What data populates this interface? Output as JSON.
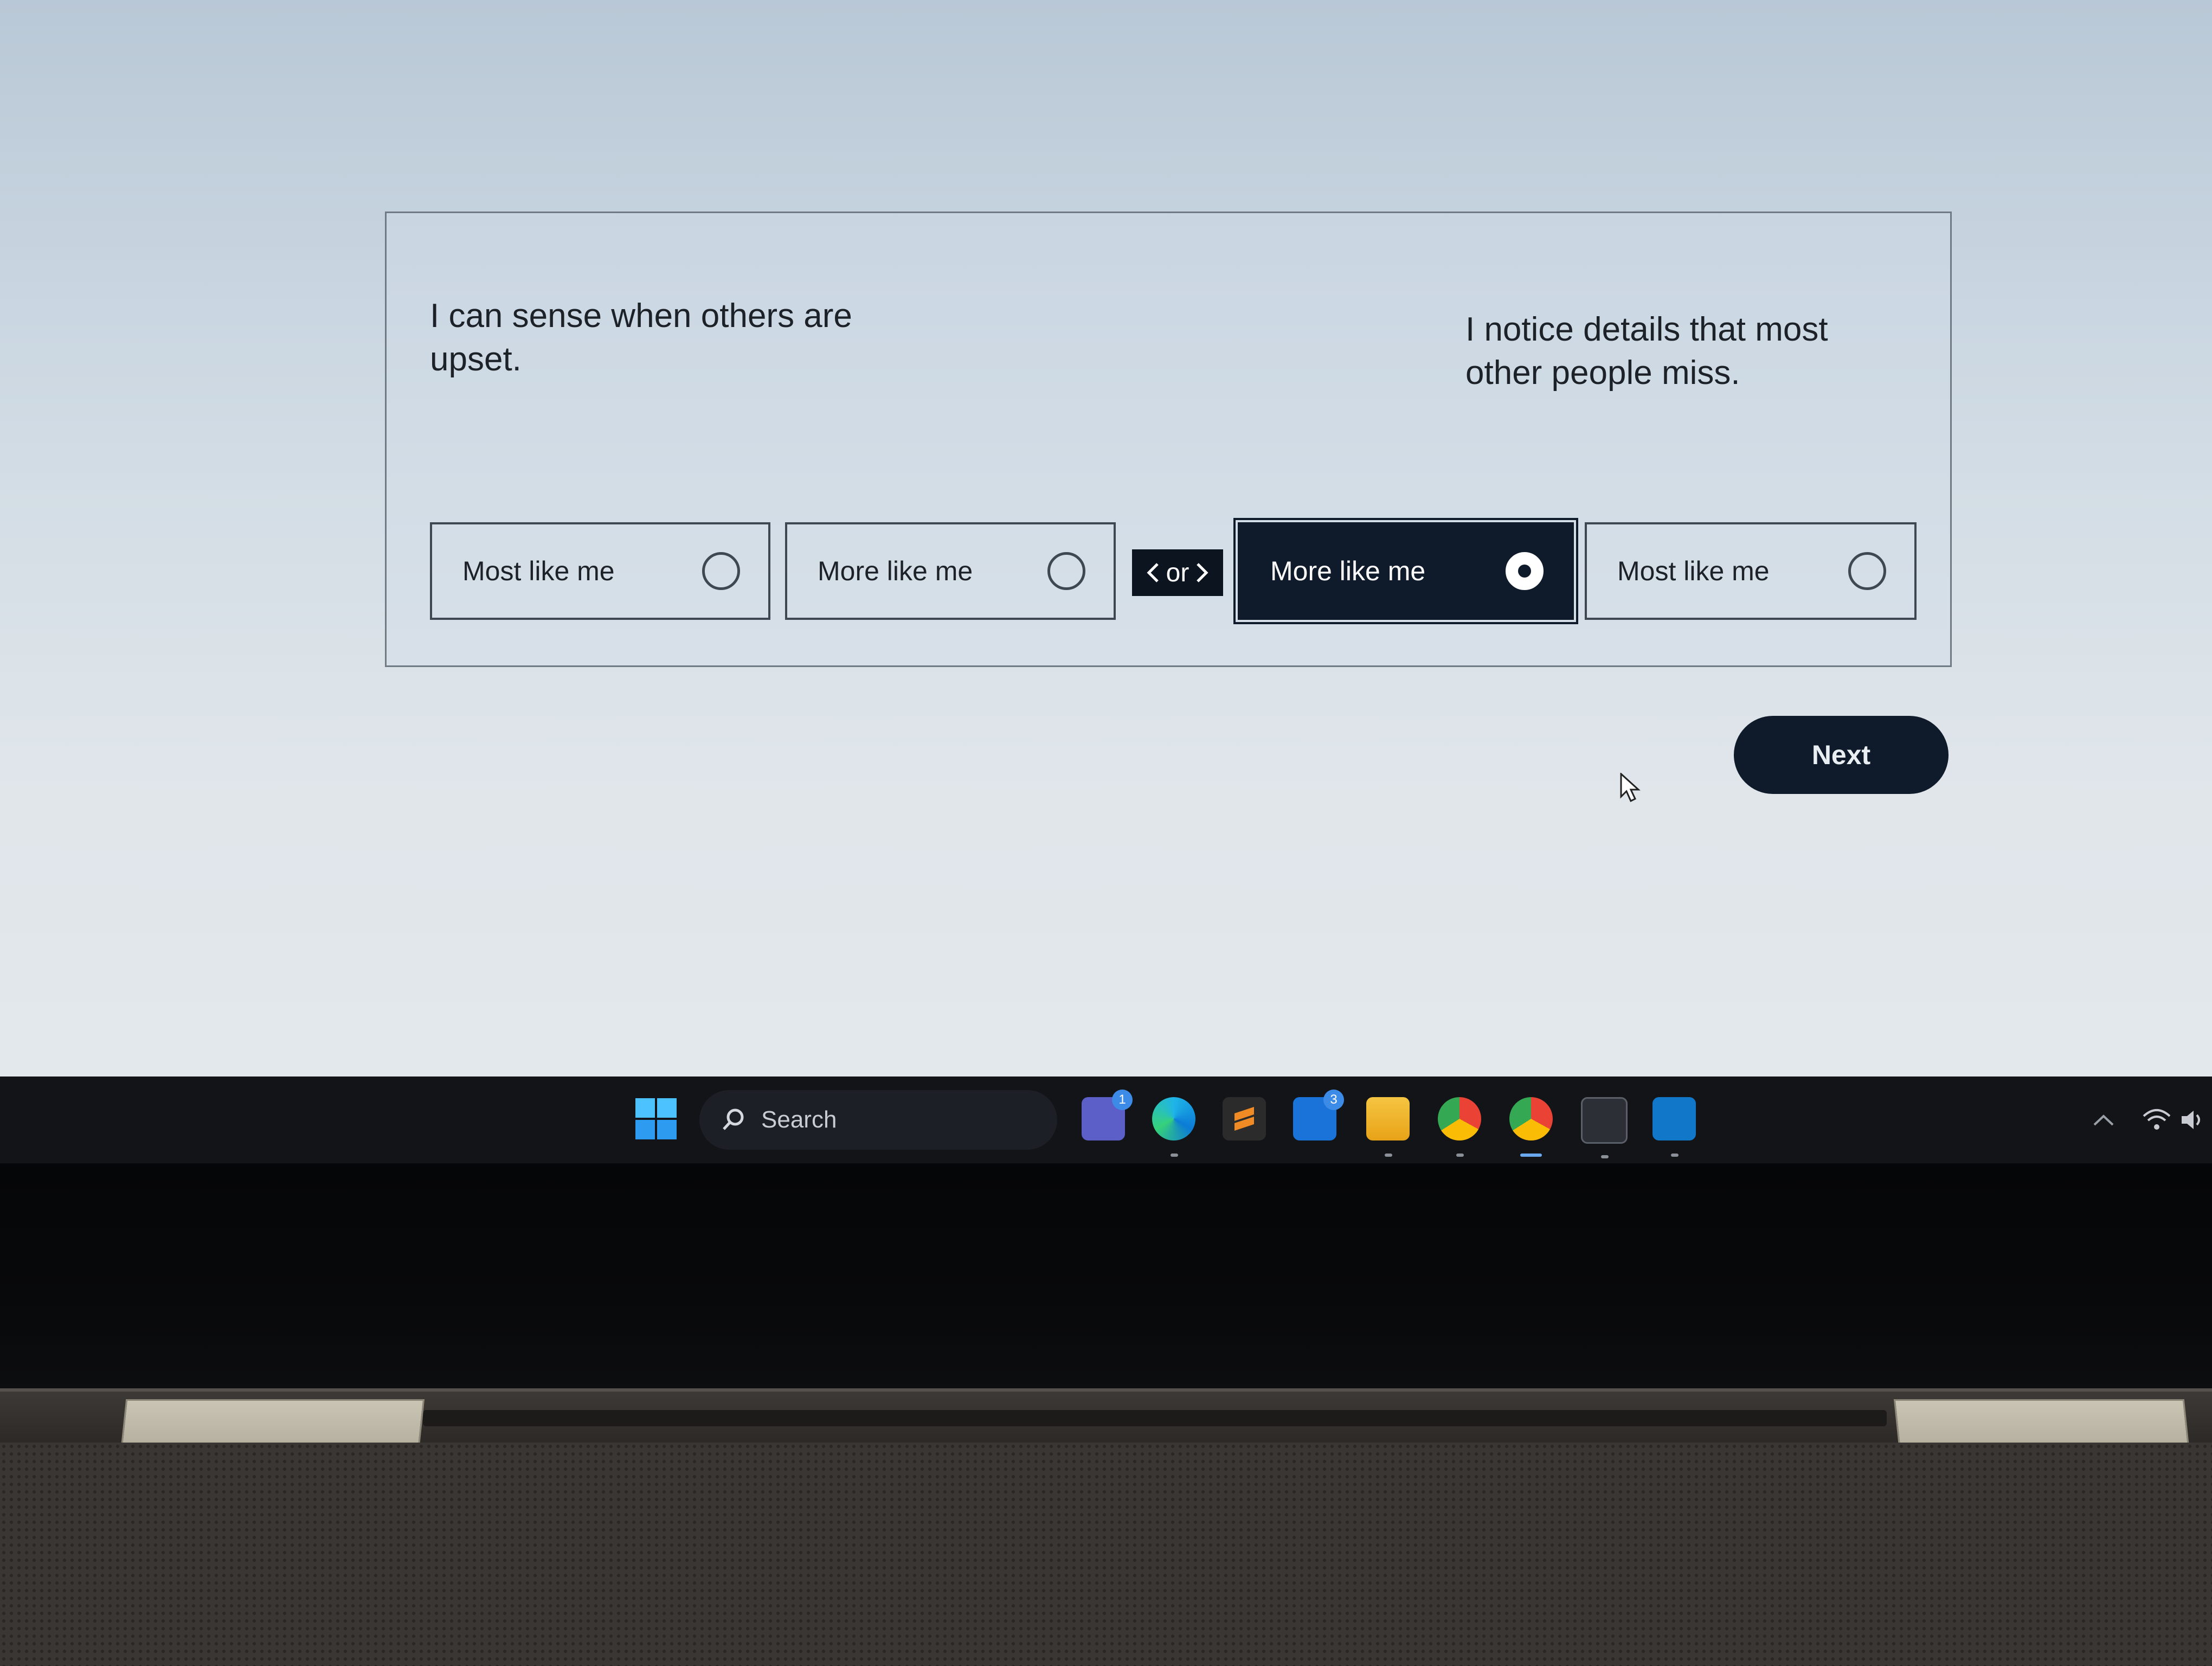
{
  "question": {
    "left_statement": "I can sense when others are upset.",
    "right_statement": "I notice details that most other people miss.",
    "options": [
      {
        "label": "Most like me",
        "selected": false
      },
      {
        "label": "More like me",
        "selected": false
      },
      {
        "label": "More like me",
        "selected": true
      },
      {
        "label": "Most like me",
        "selected": false
      }
    ],
    "divider_label": "or"
  },
  "actions": {
    "next_label": "Next"
  },
  "taskbar": {
    "search_label": "Search",
    "apps": [
      {
        "icon": "teams-icon",
        "badge": "1"
      },
      {
        "icon": "edge-icon"
      },
      {
        "icon": "sublime-text-icon"
      },
      {
        "icon": "mail-icon",
        "badge": "3"
      },
      {
        "icon": "file-explorer-icon"
      },
      {
        "icon": "chrome-icon"
      },
      {
        "icon": "chrome-profile-icon",
        "active": true
      },
      {
        "icon": "terminal-icon"
      },
      {
        "icon": "vscode-icon"
      }
    ]
  },
  "colors": {
    "selected_bg": "#0f1b2b",
    "next_bg": "#0f1b2b"
  }
}
